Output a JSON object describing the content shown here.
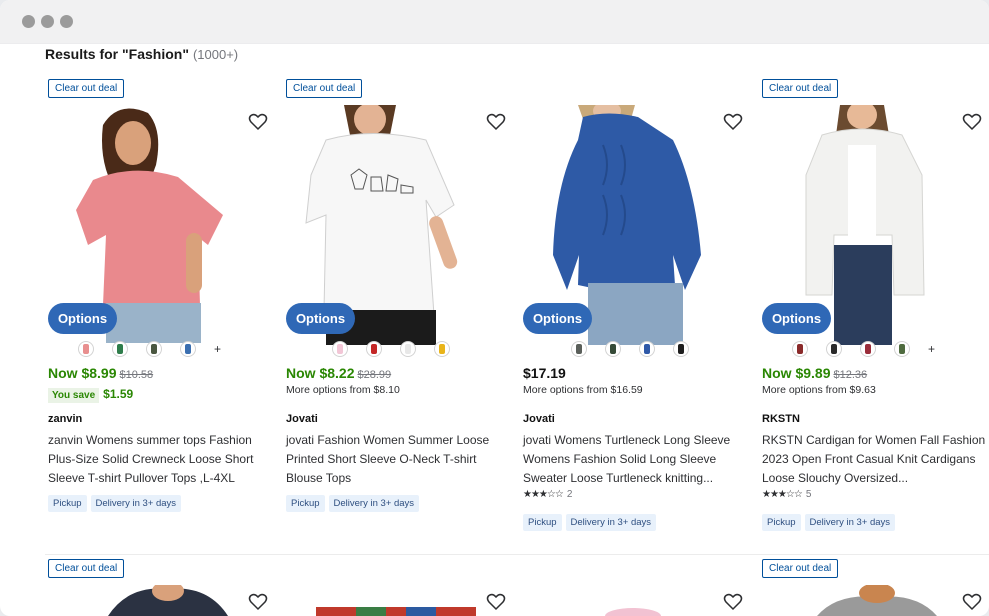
{
  "window": {
    "controls": [
      "window-dot",
      "window-dot",
      "window-dot"
    ]
  },
  "header": {
    "title": "Results for \"Fashion\"",
    "count": "(1000+)"
  },
  "common": {
    "deal_label": "Clear out deal",
    "options_label": "Options",
    "plus_label": "+",
    "pickup_label": "Pickup",
    "delivery_label": "Delivery in 3+ days",
    "you_save_label": "You save"
  },
  "products": [
    {
      "price_now": "Now $8.99",
      "price_was": "$10.58",
      "savings": "$1.59",
      "brand": "zanvin",
      "title": "zanvin Womens summer tops Fashion Plus-Size Solid Crewneck Loose Short Sleeve T-shirt Pullover Tops ,L-4XL",
      "swatch_colors": [
        "#e88f8f",
        "#2f7d4b",
        "#4a5740",
        "#3b6fb0"
      ],
      "image_colors": {
        "garment": "#e9898d",
        "skin": "#d9a17b",
        "hair": "#4a2a18"
      }
    },
    {
      "price_now": "Now $8.22",
      "price_was": "$28.99",
      "more_options": "More options from $8.10",
      "brand": "Jovati",
      "title": "jovati Fashion Women Summer Loose Printed Short Sleeve O-Neck T-shirt Blouse Tops",
      "swatch_colors": [
        "#f2c6d6",
        "#c42727",
        "#e8e8e8",
        "#e9b41a"
      ],
      "image_colors": {
        "garment": "#f7f7f7",
        "skin": "#e3b394",
        "hair": "#5a3a23"
      }
    },
    {
      "price_plain": "$17.19",
      "more_options": "More options from $16.59",
      "brand": "Jovati",
      "title": "jovati Womens Turtleneck Long Sleeve Womens Fashion Solid Long Sleeve Sweater Loose Turtleneck knitting...",
      "rating_stars": "★★★☆☆",
      "rating_count": "2",
      "swatch_colors": [
        "#5a5f5a",
        "#354a37",
        "#2f59a8",
        "#1e1e1e"
      ],
      "image_colors": {
        "garment": "#2e5aa6",
        "skin": "#e5bfa2",
        "hair": "#c9a97a"
      }
    },
    {
      "price_now": "Now $9.89",
      "price_was": "$12.36",
      "more_options": "More options from $9.63",
      "brand": "RKSTN",
      "title": "RKSTN Cardigan for Women Fall Fashion 2023 Open Front Casual Knit Cardigans Loose Slouchy Oversized...",
      "rating_stars": "★★★☆☆",
      "rating_count": "5",
      "swatch_colors": [
        "#8a2a2a",
        "#2a2a2a",
        "#9a2d3a",
        "#4f6b3f"
      ],
      "image_colors": {
        "garment": "#f2f2f0",
        "skin": "#e7b997",
        "hair": "#6b4b30"
      }
    }
  ]
}
